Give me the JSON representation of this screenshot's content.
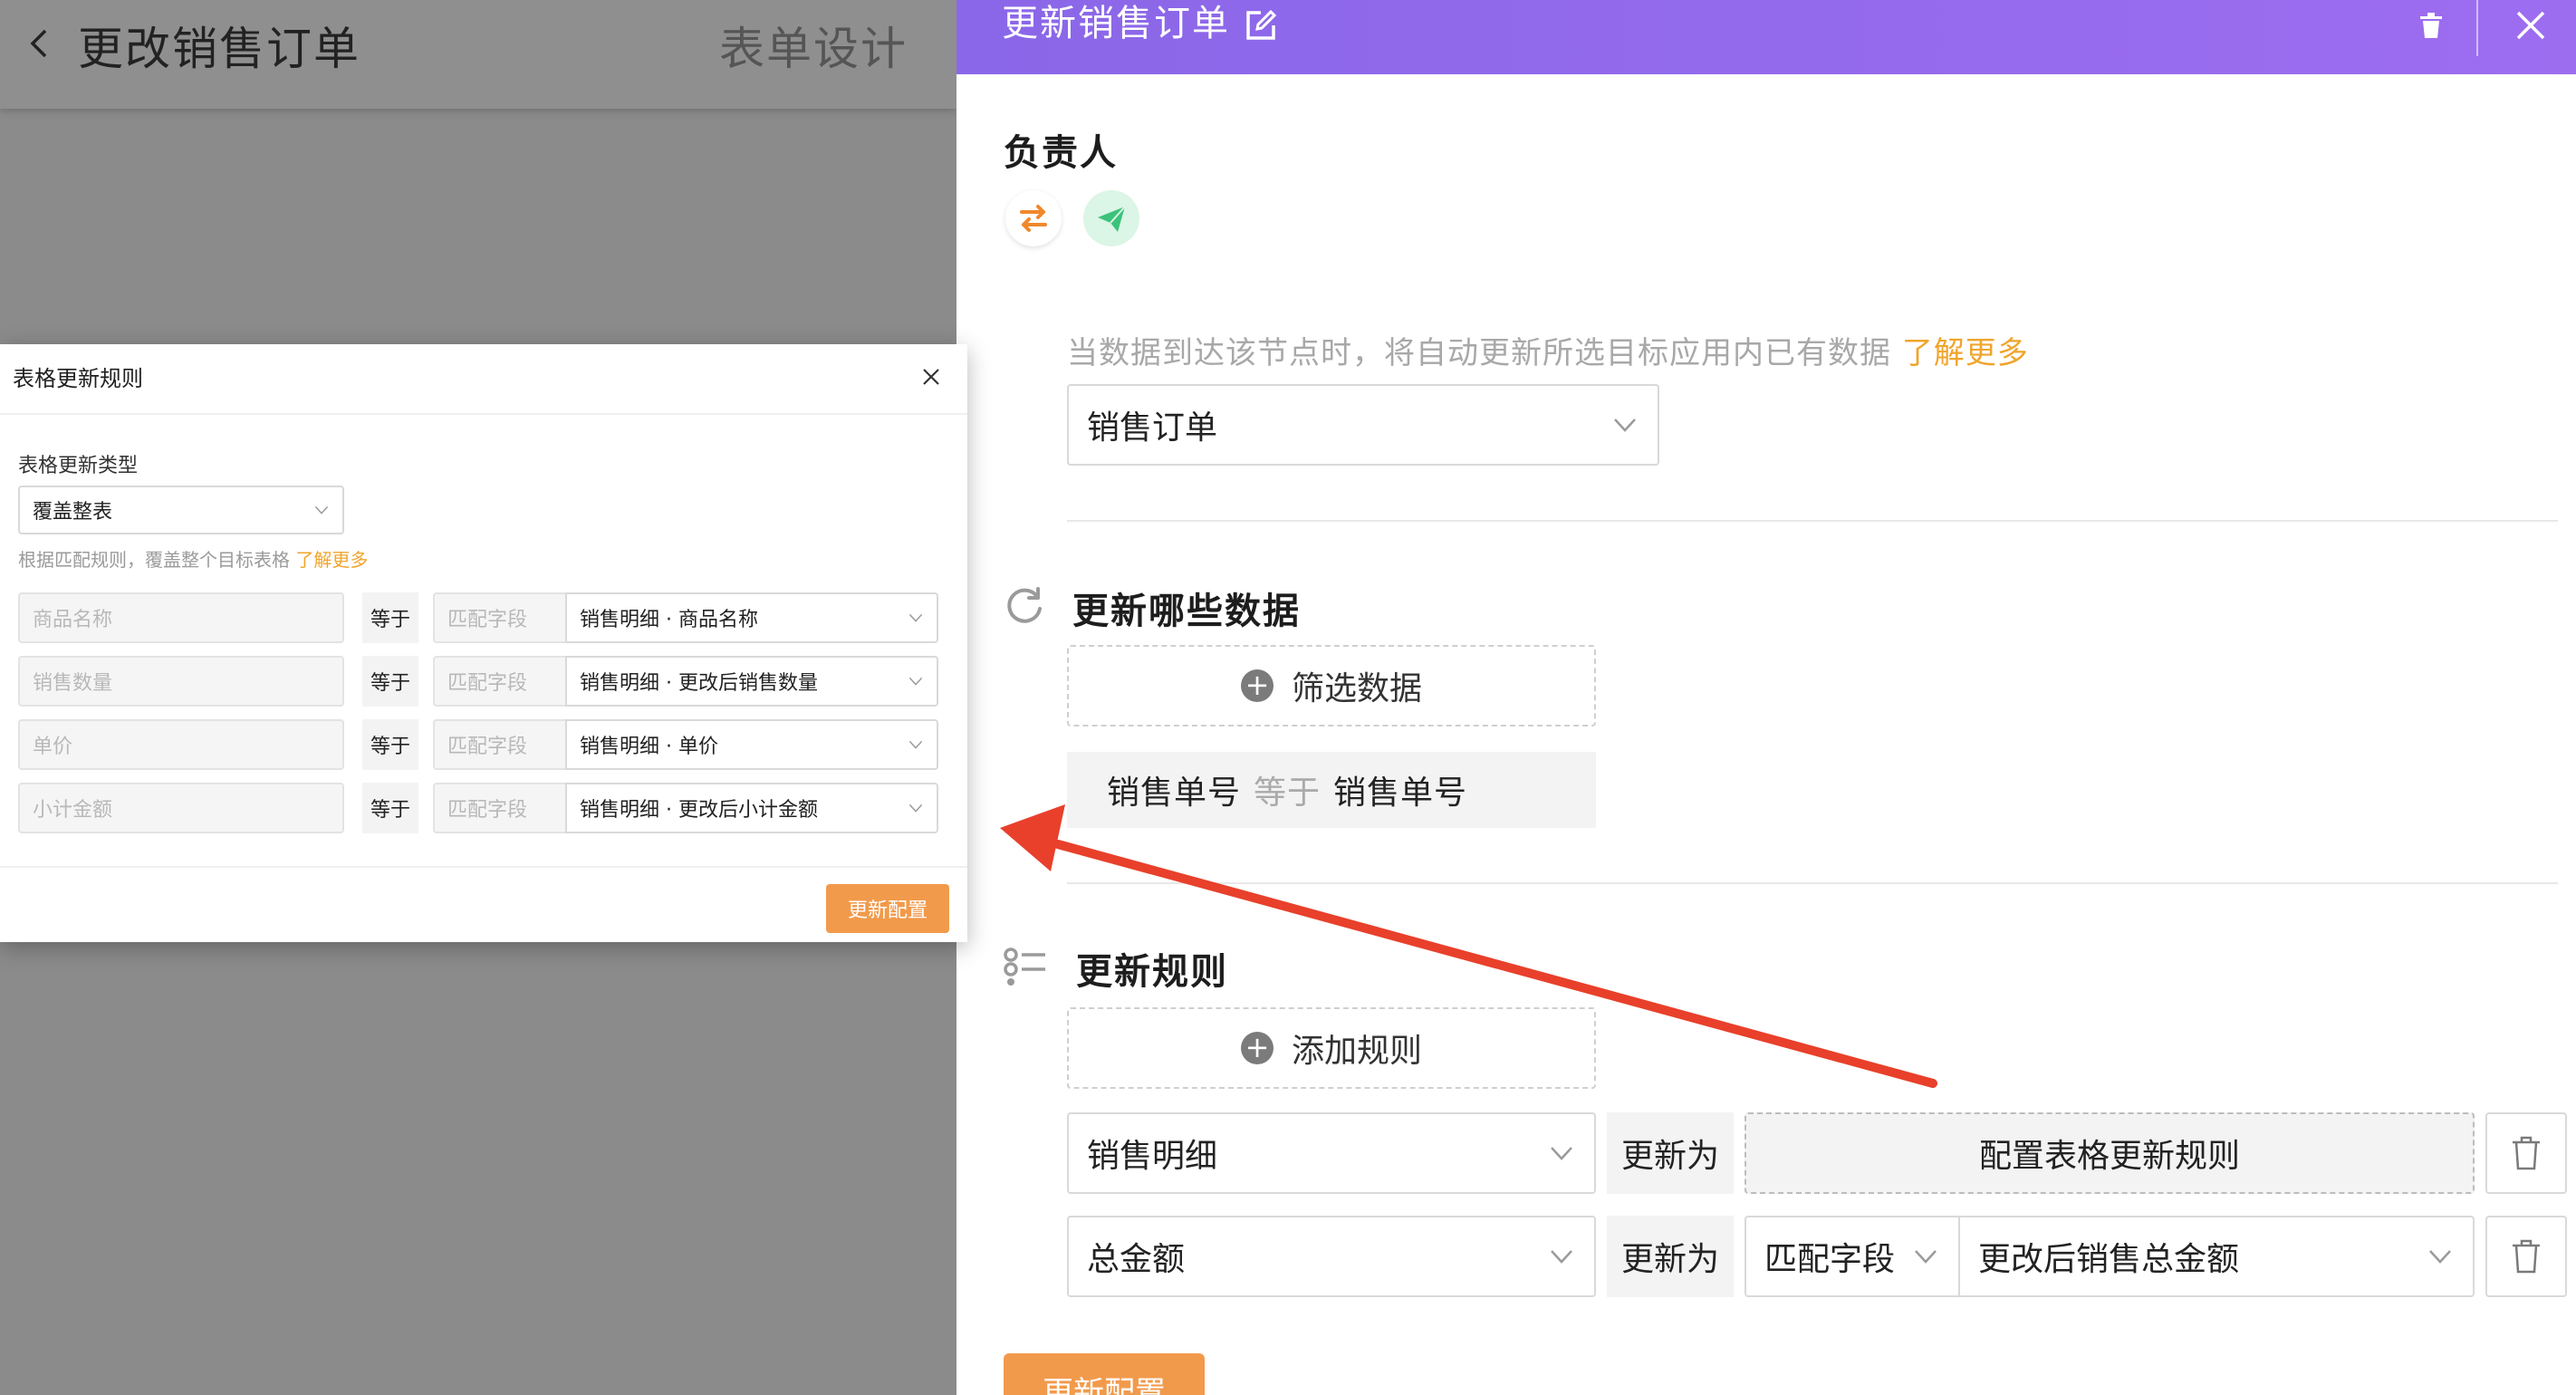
{
  "background_page": {
    "title": "更改销售订单",
    "design_tab": "表单设计"
  },
  "drawer": {
    "title": "更新销售订单",
    "owner_title": "负责人",
    "description": "当数据到达该节点时，将自动更新所选目标应用内已有数据",
    "learn_more": "了解更多",
    "target_app": "销售订单",
    "which_data_title": "更新哪些数据",
    "filter_button": "筛选数据",
    "filter_condition": {
      "field": "销售单号",
      "operator": "等于",
      "value": "销售单号"
    },
    "rules_title": "更新规则",
    "add_rule_button": "添加规则",
    "rules": [
      {
        "field": "销售明细",
        "operator": "更新为",
        "config_label": "配置表格更新规则"
      },
      {
        "field": "总金额",
        "operator": "更新为",
        "match_type": "匹配字段",
        "value": "更改后销售总金额"
      }
    ],
    "update_button": "更新配置"
  },
  "modal": {
    "title": "表格更新规则",
    "type_label": "表格更新类型",
    "type_value": "覆盖整表",
    "description": "根据匹配规则，覆盖整个目标表格",
    "learn_more": "了解更多",
    "rows": [
      {
        "source": "商品名称",
        "operator": "等于",
        "match": "匹配字段",
        "value": "销售明细 · 商品名称"
      },
      {
        "source": "销售数量",
        "operator": "等于",
        "match": "匹配字段",
        "value": "销售明细 · 更改后销售数量"
      },
      {
        "source": "单价",
        "operator": "等于",
        "match": "匹配字段",
        "value": "销售明细 · 单价"
      },
      {
        "source": "小计金额",
        "operator": "等于",
        "match": "匹配字段",
        "value": "销售明细 · 更改后小计金额"
      }
    ],
    "update_button": "更新配置"
  },
  "colors": {
    "header_gradient_start": "#8a67e8",
    "header_gradient_end": "#9d6df0",
    "accent_orange": "#f29a4b",
    "link_orange": "#f0a52c",
    "arrow_red": "#e8402b"
  }
}
